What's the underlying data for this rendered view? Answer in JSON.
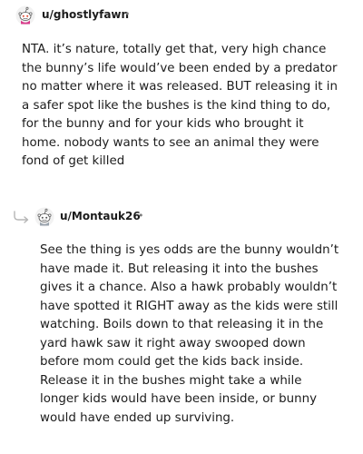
{
  "comments": [
    {
      "username": "u/ghostlyfawn",
      "separator": "•",
      "avatar_icon": "snoo-avatar-icon",
      "body": "NTA. it’s nature, totally get that, very high chance\nthe bunny’s life would’ve been ended by a predator\nno matter where it was released. BUT releasing it in\na safer spot like the bushes is the kind thing to do,\nfor the bunny and for your kids who brought it\nhome. nobody wants to see an animal they were\nfond of get killed"
    },
    {
      "username": "u/Montauk26",
      "separator": "•",
      "avatar_icon": "snoo-avatar-icon",
      "reply_icon": "reply-arrow-icon",
      "body": "See the thing is yes odds are the bunny wouldn’t\nhave made it. But releasing it into the bushes\ngives it a chance. Also a hawk probably wouldn’t\nhave spotted it RIGHT away as the kids were still\nwatching. Boils down to that releasing it in the\nyard hawk saw it right away swooped down\nbefore mom could get the kids back inside.\nRelease it in the bushes might take a while\nlonger kids would have been inside, or bunny\nwould have ended up surviving."
    }
  ]
}
